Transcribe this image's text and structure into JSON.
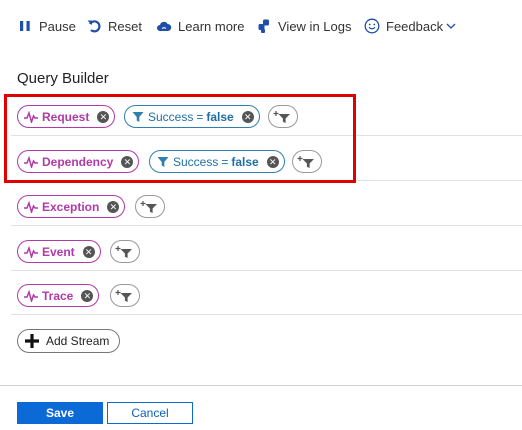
{
  "toolbar": {
    "pause_label": "Pause",
    "reset_label": "Reset",
    "learn_more_label": "Learn more",
    "view_logs_label": "View in Logs",
    "feedback_label": "Feedback"
  },
  "query_builder": {
    "title": "Query Builder",
    "streams": [
      {
        "label": "Request",
        "filter": {
          "field": "Success",
          "op": "=",
          "value": "false"
        }
      },
      {
        "label": "Dependency",
        "filter": {
          "field": "Success",
          "op": "=",
          "value": "false"
        }
      },
      {
        "label": "Exception"
      },
      {
        "label": "Event"
      },
      {
        "label": "Trace"
      }
    ],
    "add_stream_label": "Add Stream"
  },
  "footer": {
    "save_label": "Save",
    "cancel_label": "Cancel"
  },
  "colors": {
    "stream_accent": "#b03aa8",
    "filter_accent": "#2f7fb1",
    "primary_button": "#0b6ad6",
    "highlight_box": "#e00000"
  }
}
